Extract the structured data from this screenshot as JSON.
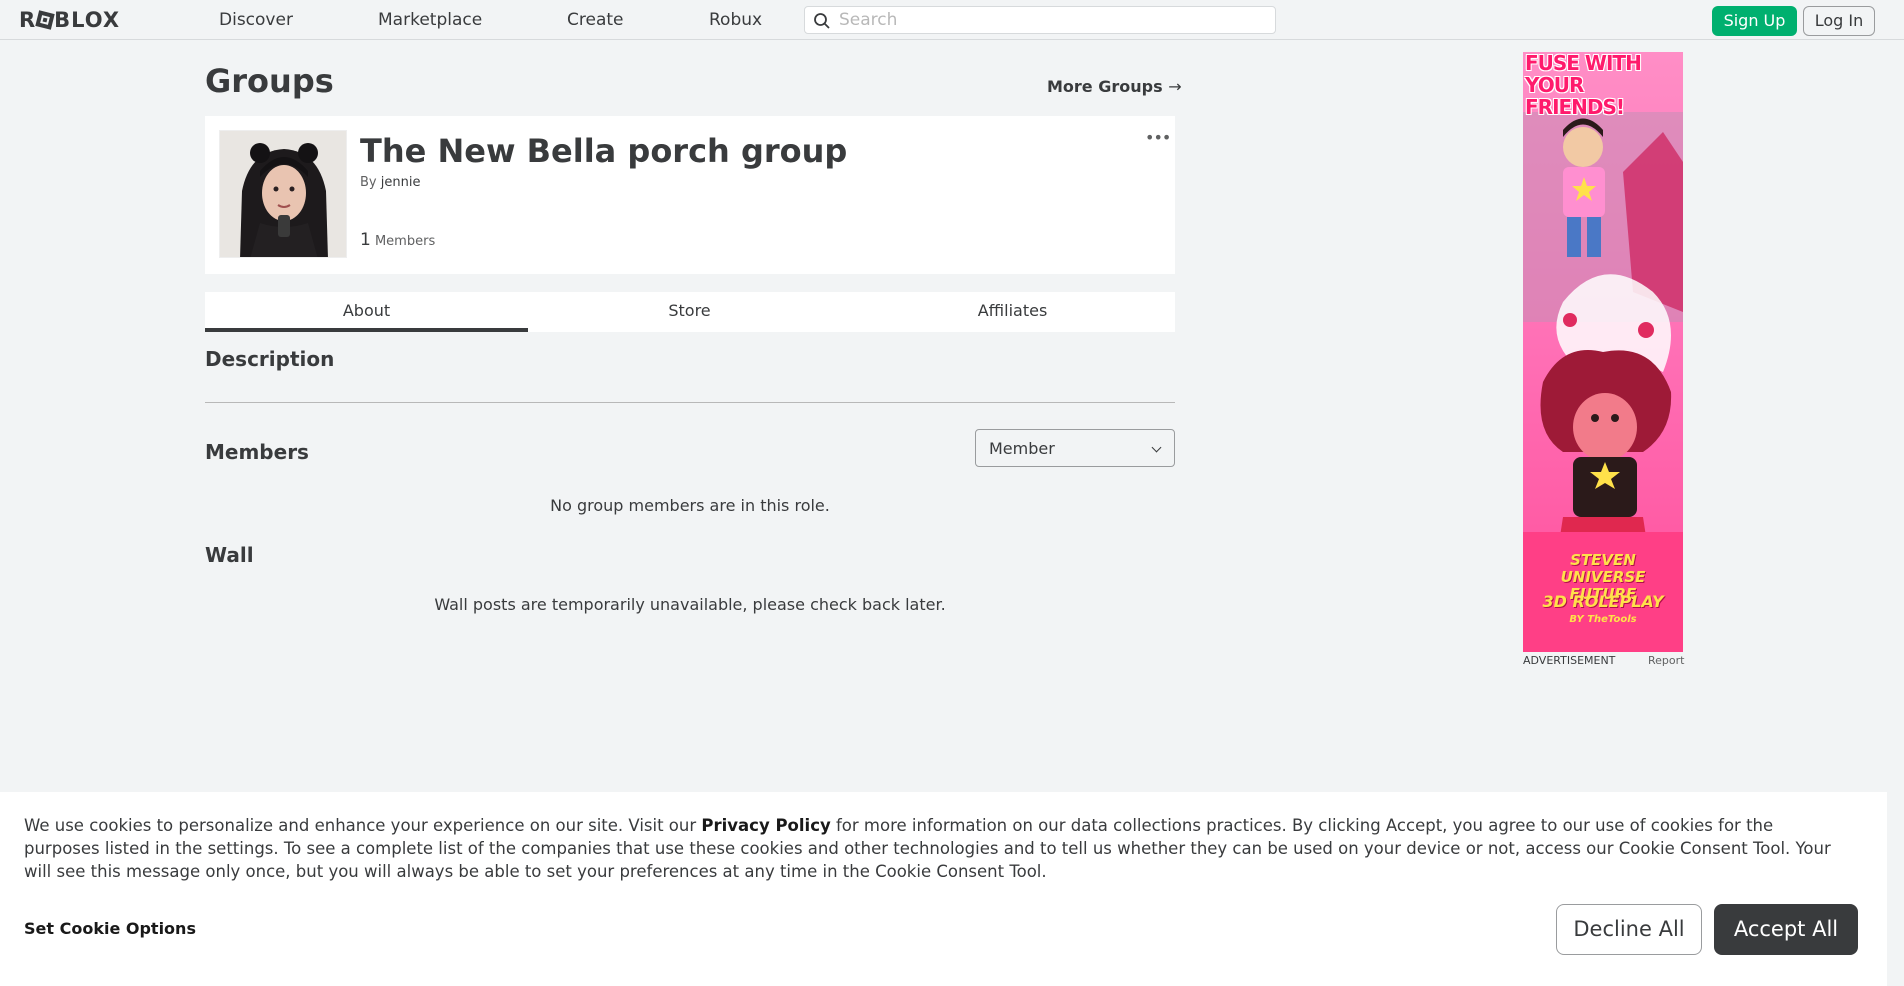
{
  "nav": {
    "logo": "ROBLOX",
    "links": [
      "Discover",
      "Marketplace",
      "Create",
      "Robux"
    ],
    "search_placeholder": "Search",
    "signup": "Sign Up",
    "login": "Log In"
  },
  "page": {
    "title": "Groups",
    "more_groups": "More Groups",
    "more_groups_arrow": "→"
  },
  "group": {
    "name": "The New Bella porch group",
    "by_prefix": "By",
    "owner": "jennie",
    "member_count": "1",
    "members_label": "Members",
    "more_menu": "•••"
  },
  "tabs": [
    "About",
    "Store",
    "Affiliates"
  ],
  "about": {
    "description_heading": "Description",
    "members_heading": "Members",
    "role_select_value": "Member",
    "no_members": "No group members are in this role.",
    "wall_heading": "Wall",
    "wall_message": "Wall posts are temporarily unavailable, please check back later."
  },
  "ad": {
    "label": "ADVERTISEMENT",
    "report": "Report",
    "headline": "FUSE WITH YOUR FRIENDS!",
    "footer_title": "STEVEN UNIVERSE FUTURE",
    "footer_sub": "3D ROLEPLAY",
    "footer_by": "BY TheTools"
  },
  "cookie": {
    "text_before": "We use cookies to personalize and enhance your experience on our site. Visit our ",
    "privacy_link": "Privacy Policy",
    "text_after": " for more information on our data collections practices. By clicking Accept, you agree to our use of cookies for the purposes listed in the settings. To see a complete list of the companies that use these cookies and other technologies and to tell us whether they can be used on your device or not, access our Cookie Consent Tool. Your will see this message only once, but you will always be able to set your preferences at any time in the Cookie Consent Tool.",
    "options": "Set Cookie Options",
    "decline": "Decline All",
    "accept": "Accept All"
  },
  "colors": {
    "signup_green": "#00b06f",
    "accept_dark": "#393b3d",
    "ad_pink": "#ff5fa8"
  }
}
